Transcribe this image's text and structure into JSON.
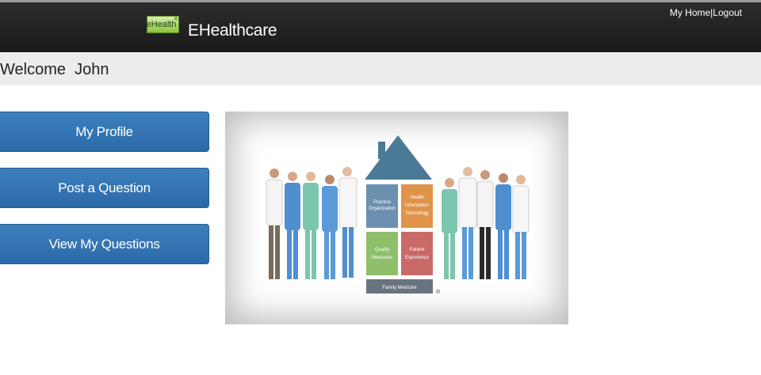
{
  "header": {
    "logo_text": "eHealth",
    "logo_sup": "®",
    "app_title": "EHealthcare",
    "my_home": "My Home",
    "separator": "|",
    "logout": "Logout"
  },
  "welcome": {
    "text": "Welcome  John"
  },
  "nav": {
    "my_profile": "My Profile",
    "post_question": "Post a Question",
    "view_questions": "View My Questions"
  },
  "hero": {
    "blocks": {
      "b1a": "Practice",
      "b1b": "Organization",
      "b2a": "Health",
      "b2b": "Information",
      "b2c": "Technology",
      "b3a": "Quality",
      "b3b": "Measures",
      "b4a": "Patient",
      "b4b": "Experience",
      "base": "Family Medicine"
    },
    "registered_mark": "®",
    "colors": {
      "roof": "#4a7a96",
      "practice": "#6b90b0",
      "health_it": "#e0944a",
      "quality": "#8fbf6a",
      "patient": "#c96a68",
      "base": "#6a7480"
    }
  },
  "colors": {
    "topbar": "#1f1f1f",
    "nav_button": "#2f6fae",
    "welcome_bg": "#ececec"
  }
}
